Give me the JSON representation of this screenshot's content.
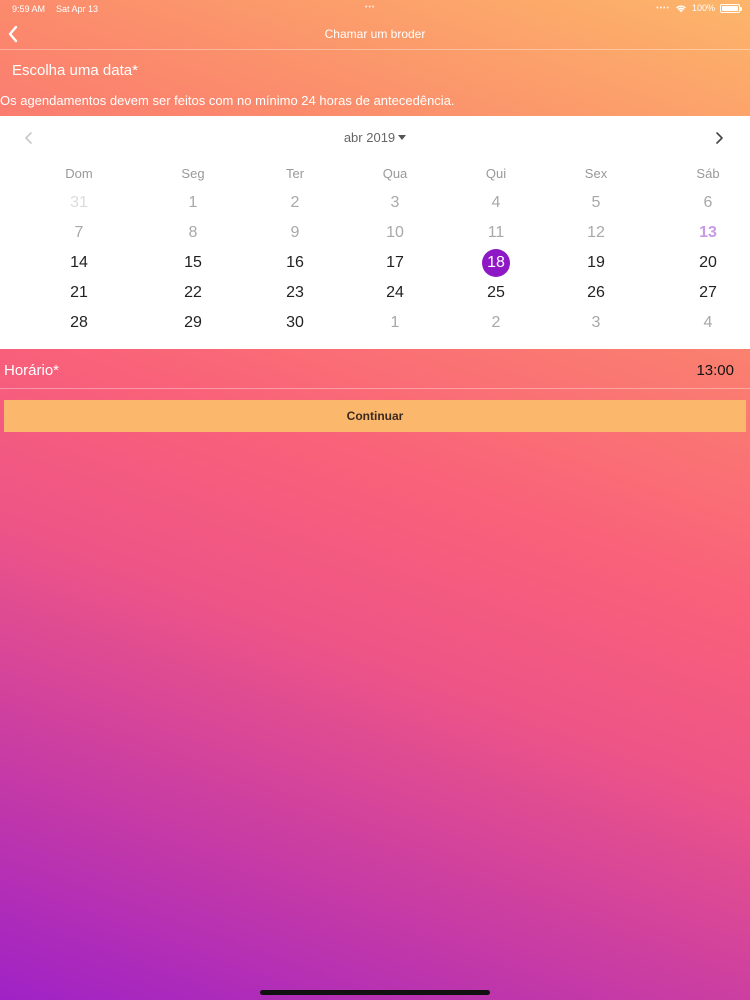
{
  "status_bar": {
    "time": "9:59 AM",
    "date": "Sat Apr 13",
    "battery": "100%",
    "icons": [
      "wifi-icon",
      "battery-icon"
    ]
  },
  "nav": {
    "title": "Chamar um broder",
    "back_icon": "chevron-left-icon"
  },
  "form": {
    "date_label": "Escolha uma data*",
    "notice": "Os agendamentos devem ser feitos com no mínimo 24 horas de antecedência.",
    "time_label": "Horário*",
    "time_value": "13:00",
    "continue_label": "Continuar"
  },
  "calendar": {
    "month_label": "abr 2019",
    "weekdays": [
      "Dom",
      "Seg",
      "Ter",
      "Qua",
      "Qui",
      "Sex",
      "Sáb"
    ],
    "weeks": [
      [
        "31",
        "1",
        "2",
        "3",
        "4",
        "5",
        "6"
      ],
      [
        "7",
        "8",
        "9",
        "10",
        "11",
        "12",
        "13"
      ],
      [
        "14",
        "15",
        "16",
        "17",
        "18",
        "19",
        "20"
      ],
      [
        "21",
        "22",
        "23",
        "24",
        "25",
        "26",
        "27"
      ],
      [
        "28",
        "29",
        "30",
        "1",
        "2",
        "3",
        "4"
      ]
    ],
    "selected_day": "18",
    "today_day": "13"
  },
  "colors": {
    "selected": "#8e18c6",
    "today": "#c99ae6",
    "button": "#fbb76b",
    "gradient_top": "#fcb66a",
    "gradient_mid": "#f9607a",
    "gradient_bottom": "#9f22c6"
  }
}
